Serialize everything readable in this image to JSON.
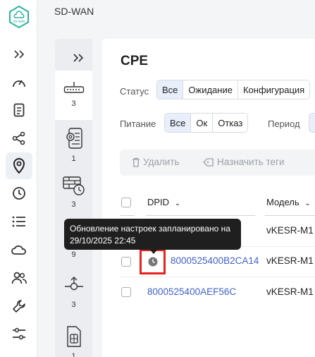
{
  "app": {
    "title": "SD-WAN",
    "logo_text": "SD-WAN"
  },
  "left_rail": {
    "icons": [
      "collapse-chevrons-icon",
      "dashboard-gauge-icon",
      "document-icon",
      "share-nodes-icon",
      "location-pin-icon",
      "clock-icon",
      "list-icon",
      "cloud-icon",
      "users-icon",
      "wrench-icon",
      "sliders-icon"
    ]
  },
  "sub_rail": {
    "items": [
      {
        "icon": "router-icon",
        "count": "3"
      },
      {
        "icon": "settings-document-icon",
        "count": "1"
      },
      {
        "icon": "firewall-timer-icon",
        "count": "3"
      },
      {
        "icon": "hidden-icon",
        "count": "9"
      },
      {
        "icon": "network-node-icon",
        "count": "3"
      },
      {
        "icon": "sim-card-icon",
        "count": "1"
      }
    ]
  },
  "page": {
    "title": "CPE"
  },
  "filters": {
    "status_label": "Статус",
    "status_options": [
      "Все",
      "Ожидание",
      "Конфигурация"
    ],
    "power_label": "Питание",
    "power_options": [
      "Все",
      "Ок",
      "Отказ"
    ],
    "period_label": "Период"
  },
  "toolbar": {
    "delete_label": "Удалить",
    "assign_tags_label": "Назначить теги"
  },
  "table": {
    "columns": {
      "dpid": "DPID",
      "model": "Модель"
    },
    "rows": [
      {
        "dpid": "",
        "model": "vKESR-M1"
      },
      {
        "dpid": "8000525400B2CA14",
        "model": "vKESR-M1"
      },
      {
        "dpid": "8000525400AEF56C",
        "model": "vKESR-M1"
      }
    ]
  },
  "tooltip": {
    "line1": "Обновление настроек запланировано на",
    "line2": "29/10/2025 22:45"
  },
  "colors": {
    "accent": "#3f62c9",
    "highlight": "#e52222",
    "logo": "#2bb5a0"
  }
}
